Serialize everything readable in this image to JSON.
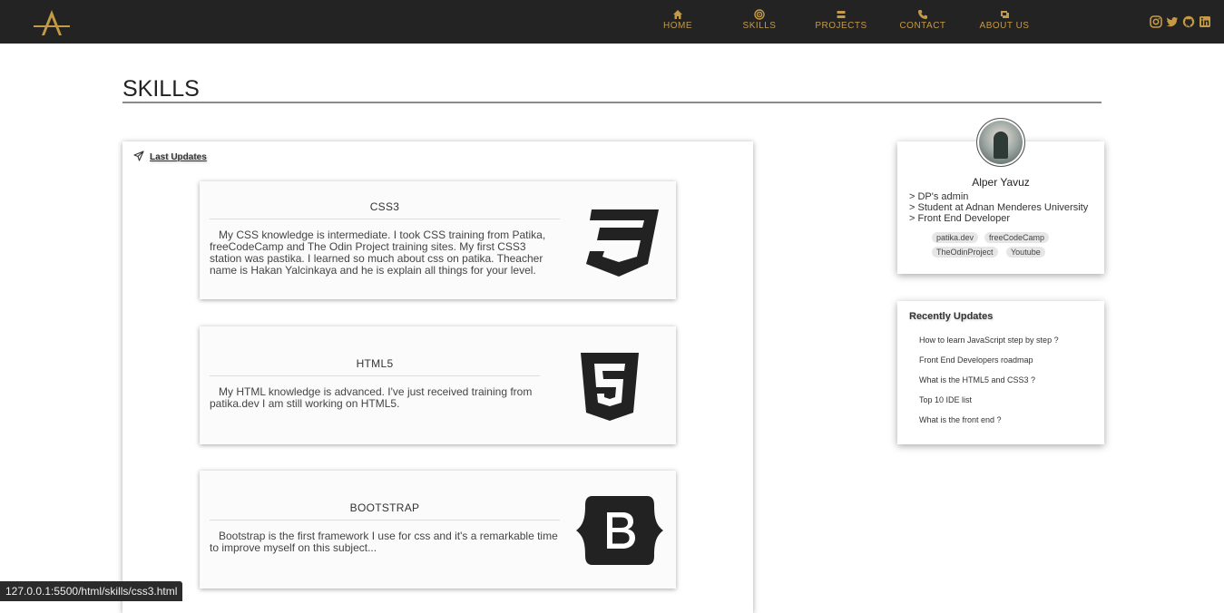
{
  "navbar": {
    "items": [
      {
        "label": "HOME",
        "icon": "home-icon"
      },
      {
        "label": "SKILLS",
        "icon": "bullseye-icon"
      },
      {
        "label": "PROJECTS",
        "icon": "layers-icon"
      },
      {
        "label": "CONTACT",
        "icon": "phone-icon"
      },
      {
        "label": "ABOUT US",
        "icon": "address-card-icon"
      }
    ],
    "social": [
      "instagram-icon",
      "twitter-icon",
      "github-icon",
      "linkedin-icon"
    ],
    "accent": "#c49a45",
    "background": "#232323"
  },
  "page": {
    "title": "SKILLS"
  },
  "main": {
    "last_updates": "Last Updates",
    "cards": [
      {
        "title": "CSS3",
        "text": "My CSS knowledge is intermediate. I took CSS training from Patika, freeCodeCamp and The Odin Project training sites. My first CSS3 station was pastika. I learned so much about css on patika. Theacher name is Hakan Yalcinkaya and he is explain all things for your level.",
        "logo": "css3-logo"
      },
      {
        "title": "HTML5",
        "text": "My HTML knowledge is advanced. I've just received training from patika.dev I am still working on HTML5.",
        "logo": "html5-logo"
      },
      {
        "title": "BOOTSTRAP",
        "text": "Bootstrap is the first framework I use for css and it's a remarkable time to improve myself on this subject...",
        "logo": "bootstrap-logo"
      }
    ]
  },
  "profile": {
    "name": "Alper Yavuz",
    "lines": [
      "> DP's admin",
      "> Student at Adnan Menderes University",
      "> Front End Developer"
    ],
    "tags": [
      "patika.dev",
      "freeCodeCamp",
      "TheOdinProject",
      "Youtube"
    ]
  },
  "recent": {
    "title": "Recently Updates",
    "links": [
      "How to learn JavaScript step by step ?",
      "Front End Developers roadmap",
      "What is the HTML5 and CSS3 ?",
      "Top 10 IDE list",
      "What is the front end ?"
    ]
  },
  "status_bar": {
    "url": "127.0.0.1:5500/html/skills/css3.html"
  }
}
